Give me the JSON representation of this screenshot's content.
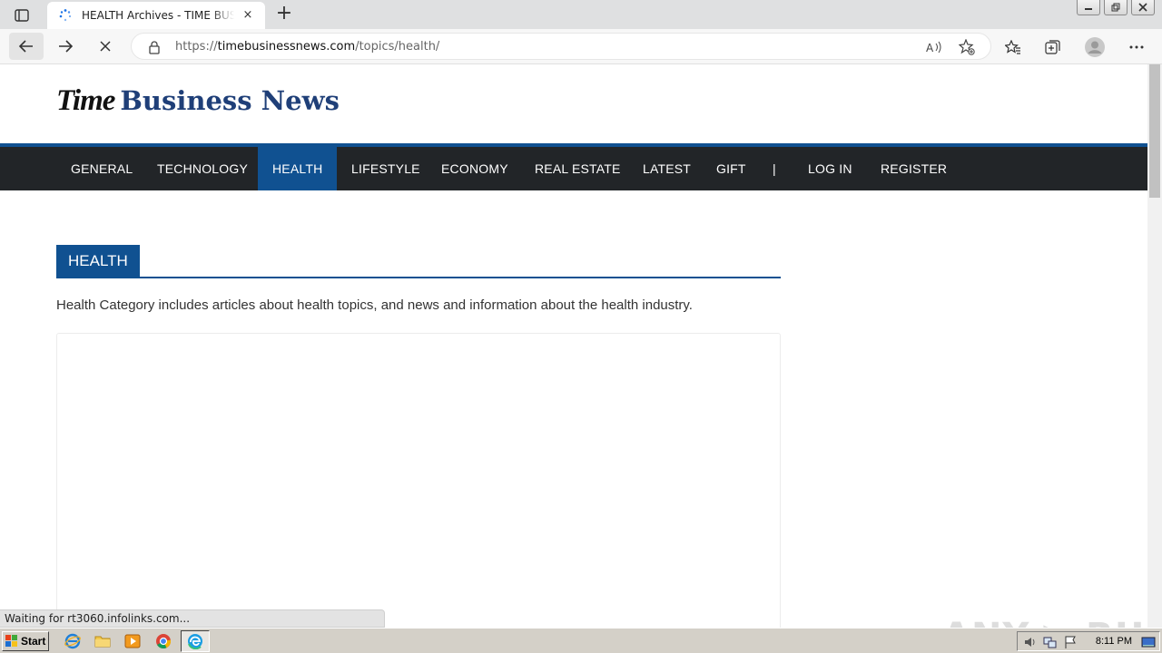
{
  "browser": {
    "tab_title": "HEALTH Archives - TIME BUSINESS NEWS",
    "tab_close": "×",
    "new_tab": "+",
    "url_prefix": "https://",
    "url_host": "timebusinessnews.com",
    "url_path": "/topics/health/",
    "status_text": "Waiting for rt3060.infolinks.com..."
  },
  "site": {
    "logo_part1": "Time",
    "logo_part2": "Business News"
  },
  "nav": {
    "items": [
      {
        "label": "GENERAL"
      },
      {
        "label": "TECHNOLOGY"
      },
      {
        "label": "HEALTH"
      },
      {
        "label": "LIFESTYLE"
      },
      {
        "label": "ECONOMY"
      },
      {
        "label": "REAL ESTATE"
      },
      {
        "label": "LATEST"
      },
      {
        "label": "GIFT"
      },
      {
        "label": "|"
      },
      {
        "label": "LOG IN"
      },
      {
        "label": "REGISTER"
      }
    ],
    "active": "HEALTH"
  },
  "section": {
    "title": "HEALTH",
    "description": "Health Category includes articles about health topics, and news and information about the health industry."
  },
  "watermark": "ANY ▷ RUN",
  "taskbar": {
    "start_label": "Start",
    "clock": "8:11 PM"
  },
  "colors": {
    "brand_blue": "#105191",
    "nav_dark": "#222528",
    "logo_blue": "#1f3f78"
  }
}
